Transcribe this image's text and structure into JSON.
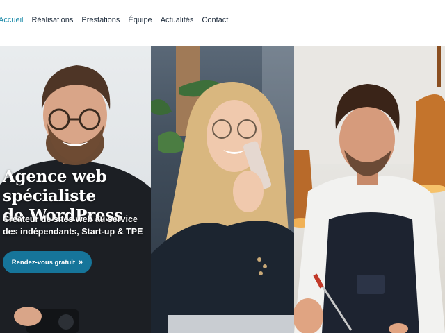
{
  "nav": {
    "items": [
      {
        "label": "Accueil",
        "active": true
      },
      {
        "label": "Réalisations"
      },
      {
        "label": "Prestations"
      },
      {
        "label": "Équipe"
      },
      {
        "label": "Actualités"
      },
      {
        "label": "Contact"
      }
    ]
  },
  "hero": {
    "title_line1": "Agence web spécialiste",
    "title_line2": "de WordPress",
    "subtitle_line1": "Créateur de sites web au service",
    "subtitle_line2": "des indépendants, Start-up & TPE",
    "cta_label": "Rendez-vous gratuit",
    "cta_icon": "double-chevron-right-icon"
  },
  "colors": {
    "accent": "#16759a",
    "active_nav": "#1b8aa8",
    "nav_text": "#1f2d3d"
  }
}
